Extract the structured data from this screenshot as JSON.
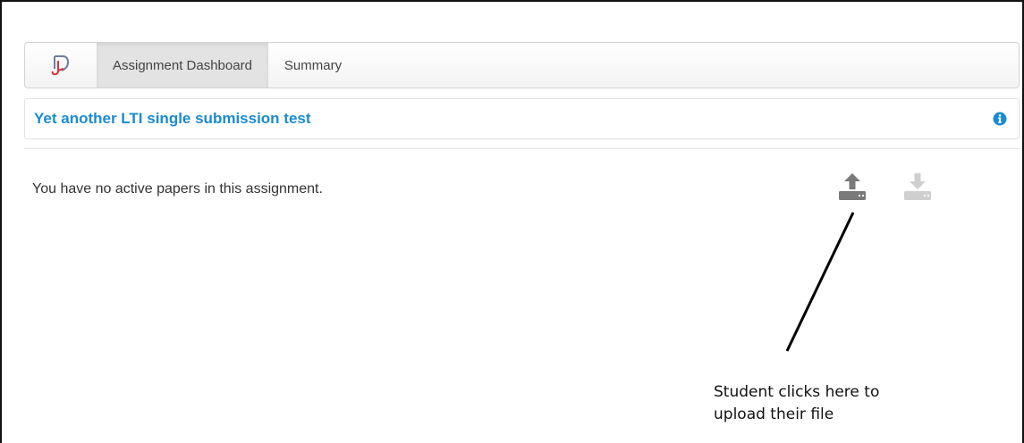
{
  "nav": {
    "logo_icon": "turnitin-feedback-studio-icon",
    "tabs": [
      {
        "label": "Assignment Dashboard",
        "active": true
      },
      {
        "label": "Summary",
        "active": false
      }
    ]
  },
  "assignment": {
    "title": "Yet another LTI single submission test",
    "info_icon": "info-circle-icon"
  },
  "main": {
    "empty_message": "You have no active papers in this assignment.",
    "upload_icon": "upload-icon",
    "download_icon": "download-icon"
  },
  "annotation": {
    "line1": "Student clicks here to",
    "line2": "upload their file"
  },
  "colors": {
    "title_blue": "#1b8bd0",
    "icon_gray": "#7a7a7a",
    "icon_disabled": "#cfcfcf"
  }
}
